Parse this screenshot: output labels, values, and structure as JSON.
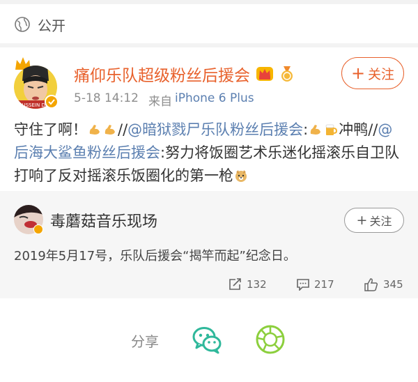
{
  "visibility": {
    "label": "公开",
    "icon": "globe-icon"
  },
  "post": {
    "author": "痛仰乐队超级粉丝后援会",
    "timestamp": "5-18 14:12",
    "source_prefix": "来自",
    "source": "iPhone 6 Plus",
    "follow_label": "关注",
    "avatar_text": "HUSSEIN DOG",
    "text": {
      "p1": "守住了啊！",
      "p2": "//",
      "mention1": "@暗狱戮尸乐队粉丝后援会",
      "p3": ":",
      "p4": "冲鸭//",
      "mention2": "@后海大鲨鱼粉丝后援会",
      "p5": ":努力将饭圈艺术乐迷化摇滚乐自卫队打响了反对摇滚乐饭圈化的第一枪"
    }
  },
  "repost": {
    "author": "毒蘑菇音乐现场",
    "follow_label": "关注",
    "text": "2019年5月17号，乐队后援会“揭竿而起”纪念日。",
    "reposts": "132",
    "comments": "217",
    "likes": "345"
  },
  "share": {
    "label": "分享",
    "wechat_icon": "wechat-icon",
    "moments_icon": "moments-icon"
  },
  "colors": {
    "accent": "#e8612c",
    "link": "#5b7fb0",
    "wechat": "#2fb89b",
    "moments": "#8ccf3d",
    "verified": "#f4a500"
  }
}
